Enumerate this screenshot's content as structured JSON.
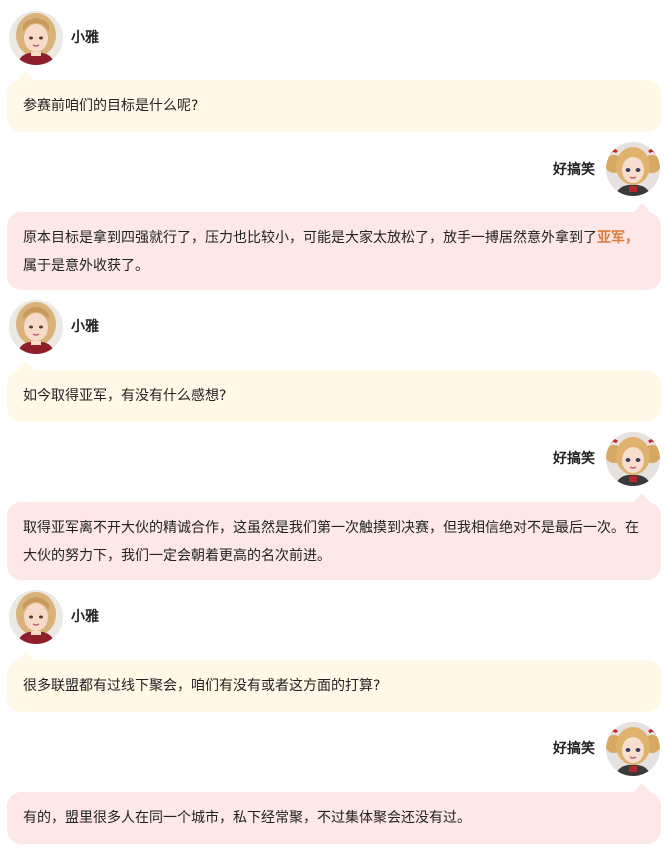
{
  "colors": {
    "question_bubble": "#fff8e6",
    "answer_bubble": "#fde8e7",
    "highlight_text": "#e07a3a"
  },
  "interviewer": {
    "name": "小雅",
    "avatar_icon": "girl-blonde-avatar-icon"
  },
  "interviewee": {
    "name": "好搞笑",
    "avatar_icon": "girl-blonde-pigtails-avatar-icon"
  },
  "messages": [
    {
      "speaker": "小雅",
      "text": "参赛前咱们的目标是什么呢?"
    },
    {
      "speaker": "好搞笑",
      "text_part1": "原本目标是拿到四强就行了，压力也比较小，可能是大家太放松了，放手一搏居然意外拿到了",
      "highlight": "亚军，",
      "text_part2": "属于是意外收获了。"
    },
    {
      "speaker": "小雅",
      "text": "如今取得亚军，有没有什么感想?"
    },
    {
      "speaker": "好搞笑",
      "text": "取得亚军离不开大伙的精诚合作，这虽然是我们第一次触摸到决赛，但我相信绝对不是最后一次。在大伙的努力下，我们一定会朝着更高的名次前进。"
    },
    {
      "speaker": "小雅",
      "text": "很多联盟都有过线下聚会，咱们有没有或者这方面的打算?"
    },
    {
      "speaker": "好搞笑",
      "text": "有的，盟里很多人在同一个城市，私下经常聚，不过集体聚会还没有过。"
    }
  ]
}
